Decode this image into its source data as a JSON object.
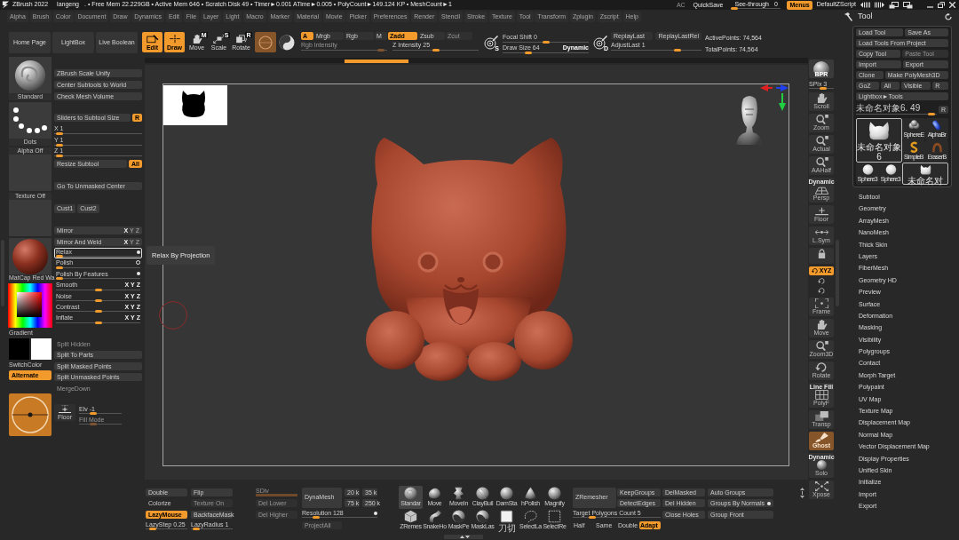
{
  "title_bar": {
    "app_name": "ZBrush 2022",
    "user": "langeng",
    "stats": ". • Free Mem 22.229GB • Active Mem 646 • Scratch Disk 49 • Timer►0.001 ATime►0.005 • PolyCount►149.124 KP • MeshCount►1",
    "buttons": [
      {
        "label": "AC",
        "disabled": true
      },
      {
        "label": "QuickSave",
        "disabled": false
      }
    ],
    "see_through": {
      "label": "See-through",
      "value": "0",
      "level": 0.0
    },
    "menus": {
      "label": "Menus",
      "on": true
    },
    "script": "DefaultZScript"
  },
  "menu_bar": [
    "Alpha",
    "Brush",
    "Color",
    "Document",
    "Draw",
    "Dynamics",
    "Edit",
    "File",
    "Layer",
    "Light",
    "Macro",
    "Marker",
    "Material",
    "Movie",
    "Picker",
    "Preferences",
    "Render",
    "Stencil",
    "Stroke",
    "Texture",
    "Tool",
    "Transform",
    "Zplugin",
    "Zscript",
    "Help"
  ],
  "top_shelf": {
    "nav": [
      "Home Page",
      "LightBox",
      "Live Boolean"
    ],
    "modes": [
      {
        "kind": "edit",
        "label": "Edit",
        "on": true
      },
      {
        "kind": "draw",
        "label": "Draw",
        "on": true
      },
      {
        "kind": "move",
        "label": "Move",
        "letter": "M",
        "on": false
      },
      {
        "kind": "scale",
        "label": "Scale",
        "letter": "S",
        "on": false
      },
      {
        "kind": "rotate",
        "label": "Rotate",
        "letter": "R",
        "on": false
      }
    ],
    "gizmo": {
      "on": true
    },
    "channels": [
      {
        "label": "A",
        "on": true,
        "disabled": false
      },
      {
        "label": "Mrgb",
        "on": false,
        "disabled": false
      },
      {
        "label": "Rgb",
        "on": false,
        "disabled": false
      },
      {
        "label": "M",
        "on": false,
        "disabled": false
      },
      {
        "label": "Zadd",
        "on": true,
        "disabled": false
      },
      {
        "label": "Zsub",
        "on": false,
        "disabled": false
      },
      {
        "label": "Zcut",
        "on": false,
        "disabled": true
      }
    ],
    "intensity": [
      {
        "label": "Rgb Intensity",
        "level": 0.97,
        "disabled": true
      },
      {
        "label": "Z Intensity 25",
        "level": 0.5,
        "disabled": false
      }
    ],
    "focal_badge": "S",
    "focal": [
      {
        "label": "Focal Shift 0",
        "level": 0.5
      },
      {
        "label": "Draw Size 64",
        "level": 0.28,
        "extra": "Dynamic"
      }
    ],
    "replay_badge": "D",
    "replay": [
      "ReplayLast",
      "ReplayLastRel"
    ],
    "adjust_last": {
      "label": "AdjustLast 1",
      "level": 0.75
    },
    "points": [
      "ActivePoints: 74,564",
      "TotalPoints: 74,564"
    ]
  },
  "left_shelf": {
    "tiles": [
      {
        "kind": "brush",
        "label": "Standard"
      },
      {
        "kind": "stroke",
        "label": "Dots"
      },
      {
        "kind": "alpha",
        "label": "Alpha Off"
      },
      {
        "kind": "texture",
        "label": "Texture Off"
      },
      {
        "kind": "material",
        "label": "MatCap Red Wa"
      }
    ],
    "gradient": "Gradient",
    "colors": [
      {
        "color": "#000000"
      },
      {
        "color": "#ffffff"
      }
    ],
    "switch_color": "SwitchColor",
    "alternate": {
      "label": "Alternate",
      "on": true
    }
  },
  "subtool_palette": {
    "top": [
      "ZBrush Scale Unify",
      "Center Subtools to World",
      "Check Mesh Volume"
    ],
    "sliders_to_size": {
      "label": "Sliders to Subtool Size",
      "toggle": {
        "label": "R",
        "on": true
      }
    },
    "size": [
      {
        "label": "X 1",
        "level": 0.02
      },
      {
        "label": "Y 1",
        "level": 0.02
      },
      {
        "label": "Z 1",
        "level": 0.02
      }
    ],
    "resize": {
      "label": "Resize Subtool",
      "toggle": {
        "label": "All",
        "on": true
      }
    },
    "center": "Go To Unmasked Center",
    "custom": [
      "Cust1",
      "Cust2"
    ],
    "mirror": [
      {
        "label": "Mirror",
        "axes": [
          {
            "label": "X",
            "on": true
          },
          {
            "label": "Y",
            "on": false
          },
          {
            "label": "Z",
            "on": false
          }
        ]
      },
      {
        "label": "Mirror And Weld",
        "axes": [
          {
            "label": "X",
            "on": true
          },
          {
            "label": "Y",
            "on": false
          },
          {
            "label": "Z",
            "on": false
          }
        ]
      }
    ],
    "deform": [
      {
        "kind": "dot",
        "label": "Relax",
        "level": 0.0,
        "highlighted": true
      },
      {
        "kind": "ring",
        "label": "Polish",
        "level": 0.0,
        "highlighted": false
      },
      {
        "kind": "dot",
        "label": "Polish By Features",
        "level": 0.0,
        "highlighted": false
      },
      {
        "kind": "xyz",
        "label": "Smooth",
        "level": 0.5,
        "highlighted": false,
        "axes": [
          {
            "label": "X",
            "on": true
          },
          {
            "label": "Y",
            "on": true
          },
          {
            "label": "Z",
            "on": true
          }
        ]
      },
      {
        "kind": "xyz",
        "label": "Noise",
        "level": 0.5,
        "highlighted": false,
        "axes": [
          {
            "label": "X",
            "on": true
          },
          {
            "label": "Y",
            "on": true
          },
          {
            "label": "Z",
            "on": true
          }
        ]
      },
      {
        "kind": "xyz",
        "label": "Contrast",
        "level": 0.5,
        "highlighted": false,
        "axes": [
          {
            "label": "X",
            "on": true
          },
          {
            "label": "Y",
            "on": true
          },
          {
            "label": "Z",
            "on": true
          }
        ]
      },
      {
        "kind": "xyz",
        "label": "Inflate",
        "level": 0.5,
        "highlighted": false,
        "axes": [
          {
            "label": "X",
            "on": true
          },
          {
            "label": "Y",
            "on": true
          },
          {
            "label": "Z",
            "on": true
          }
        ]
      }
    ],
    "split": [
      {
        "label": "Split Hidden",
        "disabled": true
      },
      {
        "label": "Split To Parts",
        "disabled": false
      },
      {
        "label": "Split Masked Points",
        "disabled": false
      },
      {
        "label": "Split Unmasked Points",
        "disabled": false
      },
      {
        "label": "MergeDown",
        "disabled": true
      }
    ],
    "floor": "Floor",
    "elevation": [
      {
        "label": "Elv -1",
        "level": 0.3,
        "disabled": false
      },
      {
        "label": "Fill Mode",
        "level": 0.3,
        "disabled": true
      }
    ]
  },
  "tooltip": "Relax By Projection",
  "bottom_bar": {
    "groups": [
      {
        "kind": "stroke",
        "items": [
          {
            "kind": "button",
            "label": "Double",
            "on": false,
            "disabled": false
          },
          {
            "kind": "button",
            "label": "Flip",
            "on": false,
            "disabled": false
          },
          {
            "kind": "text",
            "label": "Colorize",
            "on": false,
            "disabled": false
          },
          {
            "kind": "text",
            "label": "Texture On",
            "on": false,
            "disabled": true
          },
          {
            "kind": "button",
            "label": "LazyMouse",
            "on": true,
            "disabled": false
          },
          {
            "kind": "button",
            "label": "BackfaceMask",
            "on": false,
            "disabled": false
          },
          {
            "kind": "slider",
            "label": "LazyStep 0.25",
            "level": 0.1,
            "on": false,
            "disabled": false
          },
          {
            "kind": "slider",
            "label": "LazyRadius 1",
            "level": 0.05,
            "on": false,
            "disabled": false
          }
        ]
      },
      {
        "kind": "subdiv",
        "items": [
          {
            "kind": "bar",
            "label": "SDiv",
            "level": 1,
            "on": false,
            "disabled": true
          },
          {
            "kind": "button",
            "label": "Del Lower",
            "on": false,
            "disabled": true
          },
          {
            "kind": "button",
            "label": "Del Higher",
            "on": false,
            "disabled": true
          }
        ]
      },
      {
        "kind": "dynamesh",
        "items": [
          {
            "kind": "tall",
            "label": "DynaMesh",
            "on": false,
            "disabled": false
          },
          {
            "kind": "button",
            "label": "20 k",
            "on": false,
            "disabled": false
          },
          {
            "kind": "button",
            "label": "35 k",
            "on": false,
            "disabled": false
          },
          {
            "kind": "button",
            "label": "75 k",
            "on": false,
            "disabled": false
          },
          {
            "kind": "button",
            "label": "250 k",
            "on": false,
            "disabled": false
          },
          {
            "kind": "dot_slider",
            "label": "Resolution 128",
            "level": 0.15,
            "on": false,
            "disabled": false
          },
          {
            "kind": "button",
            "label": "ProjectAll",
            "on": false,
            "disabled": true
          }
        ]
      },
      {
        "kind": "brushes",
        "items": [
          {
            "kind": "standard",
            "label": "Standar",
            "selected": true
          },
          {
            "kind": "blob",
            "label": "Move",
            "selected": false
          },
          {
            "kind": "twist",
            "label": "MoveIn",
            "selected": false
          },
          {
            "kind": "striped",
            "label": "ClayBuil",
            "selected": false
          },
          {
            "kind": "sphere",
            "label": "DamSta",
            "selected": false
          },
          {
            "kind": "cone",
            "label": "hPolish",
            "selected": false
          },
          {
            "kind": "sphere",
            "label": "Magnify",
            "selected": false
          },
          {
            "kind": "cube",
            "label": "ZRemes",
            "selected": false
          },
          {
            "kind": "hook",
            "label": "SnakeHo",
            "selected": false
          },
          {
            "kind": "masked",
            "label": "MaskPe",
            "selected": false
          },
          {
            "kind": "masked",
            "label": "MaskLas",
            "selected": false
          },
          {
            "kind": "square",
            "label": "刀切",
            "selected": false
          },
          {
            "kind": "lasso",
            "label": "SelectLa",
            "selected": false
          },
          {
            "kind": "rect",
            "label": "SelectRe",
            "selected": false
          }
        ]
      },
      {
        "kind": "zremesher",
        "items": [
          {
            "kind": "tall",
            "label": "ZRemesher",
            "on": false,
            "disabled": false
          },
          {
            "kind": "button",
            "label": "KeepGroups",
            "on": false,
            "disabled": false
          },
          {
            "kind": "button",
            "label": "DetectEdges",
            "on": false,
            "disabled": false
          },
          {
            "kind": "slider",
            "label": "Target Polygons Count 5",
            "level": 0.2,
            "on": false,
            "disabled": false
          },
          {
            "kind": "text",
            "label": "Half",
            "on": false,
            "disabled": false
          },
          {
            "kind": "text",
            "label": "Same",
            "on": false,
            "disabled": false
          },
          {
            "kind": "text",
            "label": "Double",
            "on": false,
            "disabled": false
          },
          {
            "kind": "text",
            "label": "Adapt",
            "on": true,
            "disabled": false
          }
        ]
      },
      {
        "kind": "cleanup",
        "items": [
          {
            "kind": "button",
            "label": "DelMasked",
            "on": false,
            "disabled": false
          },
          {
            "kind": "button",
            "label": "Del Hidden",
            "on": false,
            "disabled": false
          },
          {
            "kind": "button",
            "label": "Close Holes",
            "on": false,
            "disabled": false
          }
        ]
      },
      {
        "kind": "groups",
        "items": [
          {
            "kind": "button",
            "label": "Auto Groups",
            "on": false,
            "disabled": false
          },
          {
            "kind": "dot_button",
            "label": "Groups By Normals",
            "on": false,
            "disabled": false
          },
          {
            "kind": "button",
            "label": "Group Front",
            "on": false,
            "disabled": false
          }
        ]
      }
    ]
  },
  "right_shelf": {
    "bpr": {
      "label": "BPR"
    },
    "spix": {
      "label": "SPix 3",
      "level": 0.6
    },
    "tools": [
      {
        "kind": "scroll",
        "label": "Scroll",
        "on": false,
        "disabled": false
      },
      {
        "kind": "zoom",
        "label": "Zoom",
        "on": false,
        "disabled": false
      },
      {
        "kind": "actual",
        "label": "Actual",
        "on": false,
        "disabled": false
      },
      {
        "kind": "aahalf",
        "label": "AAHalf",
        "on": false,
        "disabled": false
      },
      {
        "kind": "persp",
        "label": "Persp",
        "note": "Dynamic",
        "on": false,
        "disabled": false
      },
      {
        "kind": "floor",
        "label": "Floor",
        "on": false,
        "disabled": false
      },
      {
        "kind": "sym",
        "label": "L.Sym",
        "on": false,
        "disabled": false
      },
      {
        "kind": "lock",
        "on": false,
        "disabled": false
      },
      {
        "kind": "xyz",
        "label": "XYZ",
        "on": true,
        "disabled": false
      },
      {
        "kind": "rot",
        "on": false,
        "disabled": false
      },
      {
        "kind": "rot",
        "on": false,
        "disabled": false
      },
      {
        "kind": "frame",
        "label": "Frame",
        "on": false,
        "disabled": false
      },
      {
        "kind": "move",
        "label": "Move",
        "on": false,
        "disabled": false
      },
      {
        "kind": "zoom3d",
        "label": "Zoom3D",
        "on": false,
        "disabled": false
      },
      {
        "kind": "rotate",
        "label": "Rotate",
        "on": false,
        "disabled": false
      },
      {
        "kind": "polyf",
        "label": "PolyF",
        "note": "Line Fill",
        "on": false,
        "disabled": false
      },
      {
        "kind": "transp",
        "label": "Transp",
        "on": false,
        "disabled": false
      },
      {
        "kind": "ghost",
        "label": "Ghost",
        "on": true,
        "disabled": true
      },
      {
        "kind": "solo",
        "label": "Solo",
        "note": "Dynamic",
        "on": false,
        "disabled": false
      },
      {
        "kind": "xpose",
        "label": "Xpose",
        "on": false,
        "disabled": false
      }
    ]
  },
  "tool_palette": {
    "title": "Tool",
    "rows": [
      [
        {
          "label": "Load Tool",
          "disabled": false
        },
        {
          "label": "Save As",
          "disabled": false
        }
      ],
      [
        {
          "label": "Load Tools From Project",
          "disabled": false
        }
      ],
      [
        {
          "label": "Copy Tool",
          "disabled": false
        },
        {
          "label": "Paste Tool",
          "disabled": true
        }
      ],
      [
        {
          "label": "Import",
          "disabled": false
        },
        {
          "label": "Export",
          "disabled": false
        }
      ],
      [
        {
          "label": "Clone",
          "disabled": false
        },
        {
          "label": "Make PolyMesh3D",
          "disabled": false
        }
      ],
      [
        {
          "label": "GoZ",
          "disabled": false
        },
        {
          "label": "All",
          "disabled": false
        },
        {
          "label": "Visible",
          "disabled": false
        },
        {
          "label": "R",
          "disabled": false
        }
      ],
      [
        {
          "label": "Lightbox►Tools",
          "disabled": false
        }
      ]
    ],
    "current": {
      "label": "未命名对象6. 49",
      "level": 0.98,
      "toggle": "R"
    },
    "thumbnails": [
      {
        "kind": "cat",
        "label": "未命名对象6",
        "selected": true
      },
      {
        "kind": "spheres",
        "label": "SphereE",
        "selected": false
      },
      {
        "kind": "capsule",
        "label": "AlphaBr",
        "selected": false
      },
      {
        "kind": "curve",
        "label": "SimpleB",
        "selected": false
      },
      {
        "kind": "arc",
        "label": "EraserB",
        "selected": false
      },
      {
        "kind": "sphere",
        "label": "Sphere3",
        "selected": false
      },
      {
        "kind": "sphere",
        "label": "Sphere3",
        "selected": false
      },
      {
        "kind": "cat",
        "label": "未命名对",
        "selected": true
      }
    ],
    "sections": [
      "Subtool",
      "Geometry",
      "ArrayMesh",
      "NanoMesh",
      "Thick Skin",
      "Layers",
      "FiberMesh",
      "Geometry HD",
      "Preview",
      "Surface",
      "Deformation",
      "Masking",
      "Visibility",
      "Polygroups",
      "Contact",
      "Morph Target",
      "Polypaint",
      "UV Map",
      "Texture Map",
      "Displacement Map",
      "Normal Map",
      "Vector Displacement Map",
      "Display Properties",
      "Unified Skin",
      "Initialize",
      "Import",
      "Export"
    ]
  }
}
